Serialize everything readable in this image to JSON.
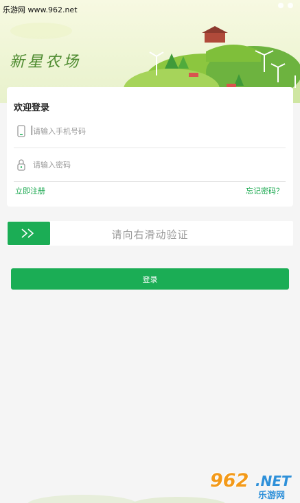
{
  "watermark_top": "乐游网 www.962.net",
  "brand_title": "新星农场",
  "login_card": {
    "title": "欢迎登录",
    "phone_placeholder": "请输入手机号码",
    "password_placeholder": "请输入密码",
    "register_link": "立即注册",
    "forgot_link": "忘记密码？"
  },
  "slider": {
    "handle_icon": "double-chevron-right-icon",
    "text": "请向右滑动验证"
  },
  "login_button": "登录",
  "logo_watermark": {
    "number": "962",
    "suffix": ".NET",
    "cn": "乐游网"
  },
  "colors": {
    "accent": "#1bad55",
    "link": "#1aa84f",
    "brand_text": "#4c8a2e",
    "background": "#f5f5f5"
  }
}
